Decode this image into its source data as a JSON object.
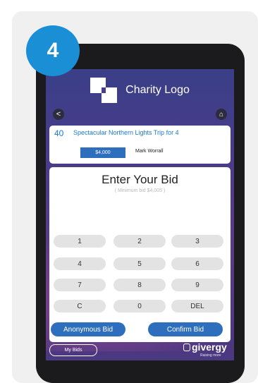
{
  "step": "4",
  "charity": {
    "logo_text": "Charity Logo"
  },
  "nav": {
    "back_glyph": "<",
    "home_glyph": "⌂"
  },
  "lot": {
    "number": "40",
    "title": "Spectacular Northern Lights Trip for 4",
    "current_bid": "$4,000",
    "bidder": "Mark Worrall"
  },
  "bid": {
    "title": "Enter Your Bid",
    "minimum": "( Minimum bid $4,005 )"
  },
  "keypad": {
    "keys": [
      "1",
      "2",
      "3",
      "4",
      "5",
      "6",
      "7",
      "8",
      "9",
      "C",
      "0",
      "DEL"
    ]
  },
  "actions": {
    "anonymous": "Anonymous Bid",
    "confirm": "Confirm Bid",
    "my_bids": "My Bids"
  },
  "brand": {
    "name": "givergy",
    "tagline": "Raising more"
  },
  "colors": {
    "accent": "#1a8fd6",
    "button": "#2d6fbd",
    "lot_text": "#1a7ac8"
  },
  "icons": [
    "back-chevron-icon",
    "home-icon",
    "givergy-logo-icon"
  ]
}
